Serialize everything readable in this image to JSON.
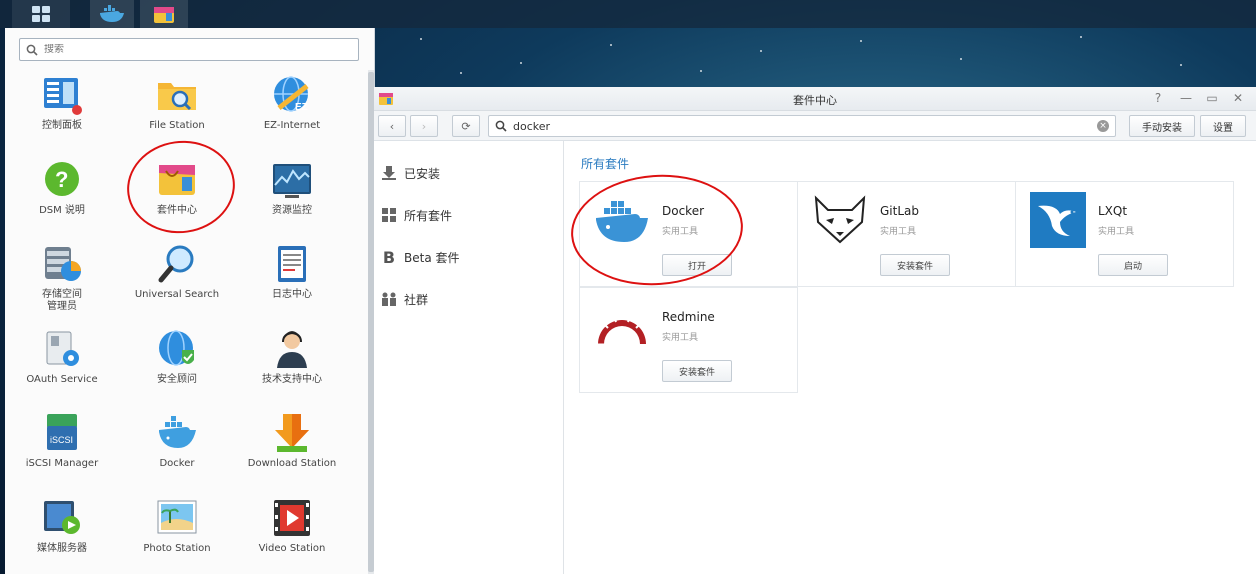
{
  "taskbar": {
    "items": [
      {
        "name": "main-menu",
        "icon": "grid-icon"
      },
      {
        "name": "docker",
        "icon": "docker-whale-icon"
      },
      {
        "name": "package-center",
        "icon": "package-bag-icon"
      }
    ]
  },
  "main_menu": {
    "search": {
      "placeholder": "搜索"
    },
    "apps": [
      {
        "label": "控制面板",
        "icon": "control-panel-icon"
      },
      {
        "label": "File Station",
        "icon": "folder-search-icon"
      },
      {
        "label": "EZ-Internet",
        "icon": "globe-ez-icon"
      },
      {
        "label": "DSM 说明",
        "icon": "help-question-icon"
      },
      {
        "label": "套件中心",
        "icon": "package-bag-icon"
      },
      {
        "label": "资源监控",
        "icon": "resource-monitor-icon"
      },
      {
        "label": "存储空间\n管理员",
        "icon": "storage-manager-icon"
      },
      {
        "label": "Universal Search",
        "icon": "magnifier-icon"
      },
      {
        "label": "日志中心",
        "icon": "log-center-icon"
      },
      {
        "label": "OAuth Service",
        "icon": "oauth-key-icon"
      },
      {
        "label": "安全顾问",
        "icon": "security-shield-icon"
      },
      {
        "label": "技术支持中心",
        "icon": "support-agent-icon"
      },
      {
        "label": "iSCSI Manager",
        "icon": "iscsi-icon"
      },
      {
        "label": "Docker",
        "icon": "docker-whale-icon"
      },
      {
        "label": "Download Station",
        "icon": "download-arrow-icon"
      },
      {
        "label": "媒体服务器",
        "icon": "media-server-icon"
      },
      {
        "label": "Photo Station",
        "icon": "photo-icon"
      },
      {
        "label": "Video Station",
        "icon": "video-play-icon"
      }
    ]
  },
  "package_window": {
    "title": "套件中心",
    "toolbar": {
      "search_value": "docker",
      "manual_install": "手动安装",
      "settings": "设置"
    },
    "sidebar": [
      {
        "label": "已安装",
        "icon": "download-icon"
      },
      {
        "label": "所有套件",
        "icon": "grid-icon"
      },
      {
        "label": "Beta 套件",
        "icon": "beta-icon"
      },
      {
        "label": "社群",
        "icon": "community-icon"
      }
    ],
    "section_title": "所有套件",
    "packages": [
      {
        "name": "Docker",
        "category": "实用工具",
        "action": "打开",
        "icon": "docker-whale-icon"
      },
      {
        "name": "GitLab",
        "category": "实用工具",
        "action": "安装套件",
        "icon": "gitlab-fox-icon"
      },
      {
        "name": "LXQt",
        "category": "实用工具",
        "action": "启动",
        "icon": "lxqt-bird-icon"
      },
      {
        "name": "Redmine",
        "category": "实用工具",
        "action": "安装套件",
        "icon": "redmine-arc-icon"
      }
    ]
  },
  "colors": {
    "accent": "#2a7bc0",
    "annotation": "#dd1111"
  }
}
